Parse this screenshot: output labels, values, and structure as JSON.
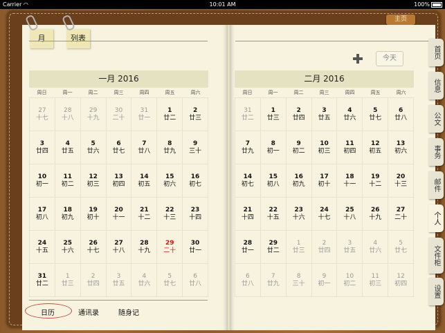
{
  "status": {
    "carrier": "Carrier",
    "wifi": "wifi-icon",
    "time": "10:01 AM",
    "battery_pct": "100%"
  },
  "top_tab": "主页",
  "view_tabs": [
    "月",
    "列表"
  ],
  "toolbar": {
    "add_icon": "plus-icon",
    "today_label": "今天"
  },
  "weekdays": [
    "周日",
    "周一",
    "周二",
    "周三",
    "周四",
    "周五",
    "周六"
  ],
  "months": [
    {
      "title": "一月 2016",
      "days": [
        [
          "27",
          "十七",
          true
        ],
        [
          "28",
          "十八",
          true
        ],
        [
          "29",
          "十九",
          true
        ],
        [
          "30",
          "二十",
          true
        ],
        [
          "31",
          "廿一",
          true
        ],
        [
          "1",
          "廿二",
          false
        ],
        [
          "2",
          "廿三",
          false
        ],
        [
          "3",
          "廿四",
          false
        ],
        [
          "4",
          "廿五",
          false
        ],
        [
          "5",
          "廿六",
          false
        ],
        [
          "6",
          "廿七",
          false
        ],
        [
          "7",
          "廿八",
          false
        ],
        [
          "8",
          "廿九",
          false
        ],
        [
          "9",
          "三十",
          false
        ],
        [
          "10",
          "初一",
          false
        ],
        [
          "11",
          "初二",
          false
        ],
        [
          "12",
          "初三",
          false
        ],
        [
          "13",
          "初四",
          false
        ],
        [
          "14",
          "初五",
          false
        ],
        [
          "15",
          "初六",
          false
        ],
        [
          "16",
          "初七",
          false
        ],
        [
          "17",
          "初八",
          false
        ],
        [
          "18",
          "初九",
          false
        ],
        [
          "19",
          "初十",
          false
        ],
        [
          "20",
          "十一",
          false
        ],
        [
          "21",
          "十二",
          false
        ],
        [
          "22",
          "十三",
          false
        ],
        [
          "23",
          "十四",
          false
        ],
        [
          "24",
          "十五",
          false
        ],
        [
          "25",
          "十六",
          false
        ],
        [
          "26",
          "十七",
          false
        ],
        [
          "27",
          "十八",
          false
        ],
        [
          "28",
          "十九",
          false
        ],
        [
          "29",
          "二十",
          false,
          true
        ],
        [
          "30",
          "廿一",
          false
        ],
        [
          "31",
          "廿二",
          false
        ],
        [
          "1",
          "廿三",
          true
        ],
        [
          "2",
          "廿四",
          true
        ],
        [
          "3",
          "廿五",
          true
        ],
        [
          "4",
          "廿六",
          true
        ],
        [
          "5",
          "廿七",
          true
        ],
        [
          "6",
          "廿八",
          true
        ]
      ]
    },
    {
      "title": "二月 2016",
      "days": [
        [
          "31",
          "廿二",
          true
        ],
        [
          "1",
          "廿三",
          false
        ],
        [
          "2",
          "廿四",
          false
        ],
        [
          "3",
          "廿五",
          false
        ],
        [
          "4",
          "廿六",
          false
        ],
        [
          "5",
          "廿七",
          false
        ],
        [
          "6",
          "廿八",
          false
        ],
        [
          "7",
          "廿九",
          false
        ],
        [
          "8",
          "初一",
          false
        ],
        [
          "9",
          "初二",
          false
        ],
        [
          "10",
          "初三",
          false
        ],
        [
          "11",
          "初四",
          false
        ],
        [
          "12",
          "初五",
          false
        ],
        [
          "13",
          "初六",
          false
        ],
        [
          "14",
          "初七",
          false
        ],
        [
          "15",
          "初八",
          false
        ],
        [
          "16",
          "初九",
          false
        ],
        [
          "17",
          "初十",
          false
        ],
        [
          "18",
          "十一",
          false
        ],
        [
          "19",
          "十二",
          false
        ],
        [
          "20",
          "十三",
          false
        ],
        [
          "21",
          "十四",
          false
        ],
        [
          "22",
          "十五",
          false
        ],
        [
          "23",
          "十六",
          false
        ],
        [
          "24",
          "十七",
          false
        ],
        [
          "25",
          "十八",
          false
        ],
        [
          "26",
          "十九",
          false
        ],
        [
          "27",
          "二十",
          false
        ],
        [
          "28",
          "廿一",
          false
        ],
        [
          "29",
          "廿二",
          false
        ],
        [
          "1",
          "廿三",
          true
        ],
        [
          "2",
          "廿四",
          true
        ],
        [
          "3",
          "廿五",
          true
        ],
        [
          "4",
          "廿六",
          true
        ],
        [
          "5",
          "廿七",
          true
        ],
        [
          "6",
          "廿八",
          true
        ],
        [
          "7",
          "廿九",
          true
        ],
        [
          "8",
          "三十",
          true
        ],
        [
          "9",
          "初一",
          true
        ],
        [
          "10",
          "初二",
          true
        ],
        [
          "11",
          "初三",
          true
        ],
        [
          "12",
          "初四",
          true
        ]
      ]
    }
  ],
  "bottom_tabs": [
    "日历",
    "通讯录",
    "随身记"
  ],
  "side_tabs": [
    "首页",
    "信息",
    "公文",
    "事务",
    "邮件",
    "个人",
    "文件柜",
    "设置"
  ],
  "side_tab_active": "个人"
}
